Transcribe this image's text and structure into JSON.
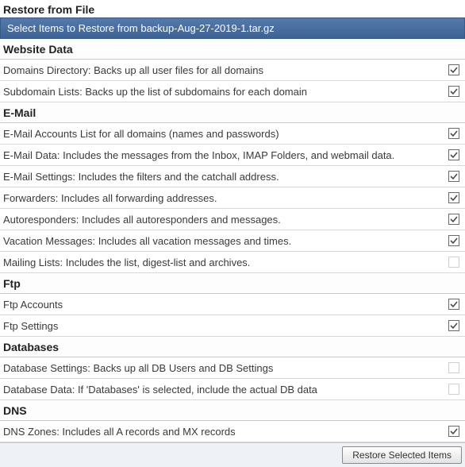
{
  "title": "Restore from File",
  "subtitle": "Select Items to Restore from backup-Aug-27-2019-1.tar.gz",
  "sections": [
    {
      "header": "Website Data",
      "items": [
        {
          "label": "Domains Directory: Backs up all user files for all domains",
          "checked": true
        },
        {
          "label": "Subdomain Lists: Backs up the list of subdomains for each domain",
          "checked": true
        }
      ]
    },
    {
      "header": "E-Mail",
      "items": [
        {
          "label": "E-Mail Accounts List for all domains (names and passwords)",
          "checked": true
        },
        {
          "label": "E-Mail Data: Includes the messages from the Inbox, IMAP Folders, and webmail data.",
          "checked": true
        },
        {
          "label": "E-Mail Settings: Includes the filters and the catchall address.",
          "checked": true
        },
        {
          "label": "Forwarders: Includes all forwarding addresses.",
          "checked": true
        },
        {
          "label": "Autoresponders: Includes all autoresponders and messages.",
          "checked": true
        },
        {
          "label": "Vacation Messages: Includes all vacation messages and times.",
          "checked": true
        },
        {
          "label": "Mailing Lists: Includes the list, digest-list and archives.",
          "checked": false
        }
      ]
    },
    {
      "header": "Ftp",
      "items": [
        {
          "label": "Ftp Accounts",
          "checked": true
        },
        {
          "label": "Ftp Settings",
          "checked": true
        }
      ]
    },
    {
      "header": "Databases",
      "items": [
        {
          "label": "Database Settings: Backs up all DB Users and DB Settings",
          "checked": false
        },
        {
          "label": "Database Data: If 'Databases' is selected, include the actual DB data",
          "checked": false
        }
      ]
    },
    {
      "header": "DNS",
      "items": [
        {
          "label": "DNS Zones: Includes all A records and MX records",
          "checked": true
        }
      ]
    }
  ],
  "button": "Restore Selected Items"
}
